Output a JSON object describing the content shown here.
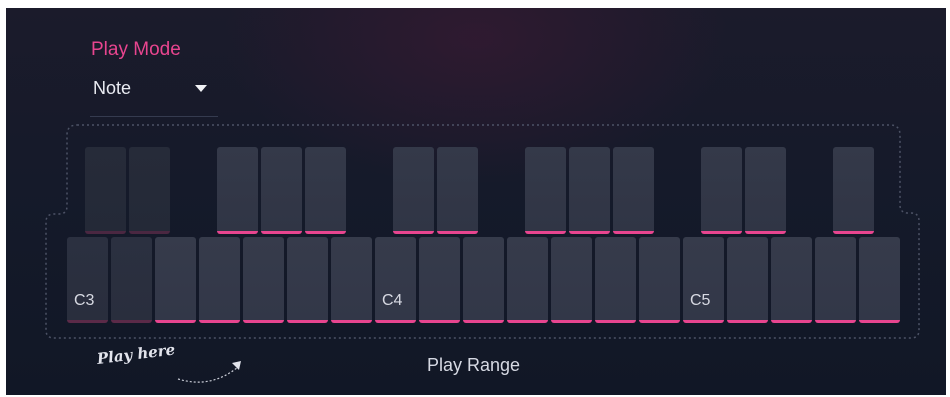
{
  "play_mode": {
    "title": "Play Mode",
    "selected": "Note",
    "caret_icon": "caret-down-icon"
  },
  "keyboard": {
    "octave_labels": [
      "C3",
      "C4",
      "C5"
    ],
    "white_keys_active": [
      false,
      false,
      true,
      true,
      true,
      true,
      true,
      true,
      true,
      true,
      true,
      true,
      true,
      true,
      true,
      true,
      true,
      true,
      true
    ],
    "black_keys_active": [
      false,
      false,
      true,
      true,
      true,
      true,
      true,
      true,
      true,
      true,
      true,
      true,
      true,
      true
    ],
    "range_label": "Play Range"
  },
  "hint": {
    "text": "Play here",
    "arrow_icon": "curved-arrow-icon"
  },
  "colors": {
    "accent": "#e8458f",
    "background": "#151a2a",
    "key": "#343949",
    "text": "#e9ebf2"
  }
}
